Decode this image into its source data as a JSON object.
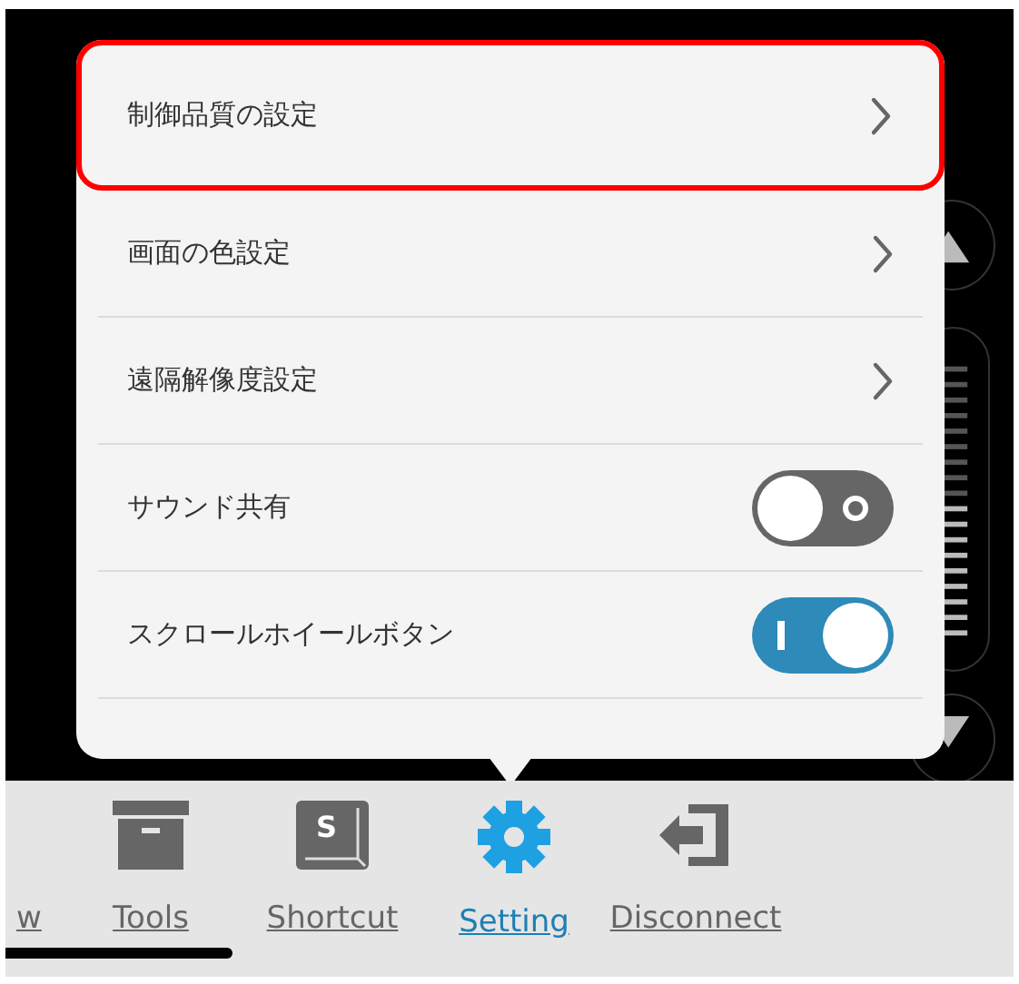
{
  "menu": {
    "items": [
      {
        "label": "制御品質の設定",
        "kind": "link",
        "highlighted": true
      },
      {
        "label": "画面の色設定",
        "kind": "link",
        "highlighted": false
      },
      {
        "label": "遠隔解像度設定",
        "kind": "link",
        "highlighted": false
      },
      {
        "label": "サウンド共有",
        "kind": "toggle",
        "on": false,
        "highlighted": false
      },
      {
        "label": "スクロールホイールボタン",
        "kind": "toggle",
        "on": true,
        "highlighted": false
      }
    ]
  },
  "scroll_slider": {
    "level": 0.5
  },
  "toolbar": {
    "tabs": [
      {
        "label": "w",
        "kind": "cut",
        "selected": false
      },
      {
        "label": "Tools",
        "kind": "box",
        "selected": false
      },
      {
        "label": "Shortcut",
        "kind": "key",
        "key_letter": "S",
        "selected": false
      },
      {
        "label": "Setting",
        "kind": "gear",
        "selected": true
      },
      {
        "label": "Disconnect",
        "kind": "exit",
        "selected": false
      }
    ]
  }
}
